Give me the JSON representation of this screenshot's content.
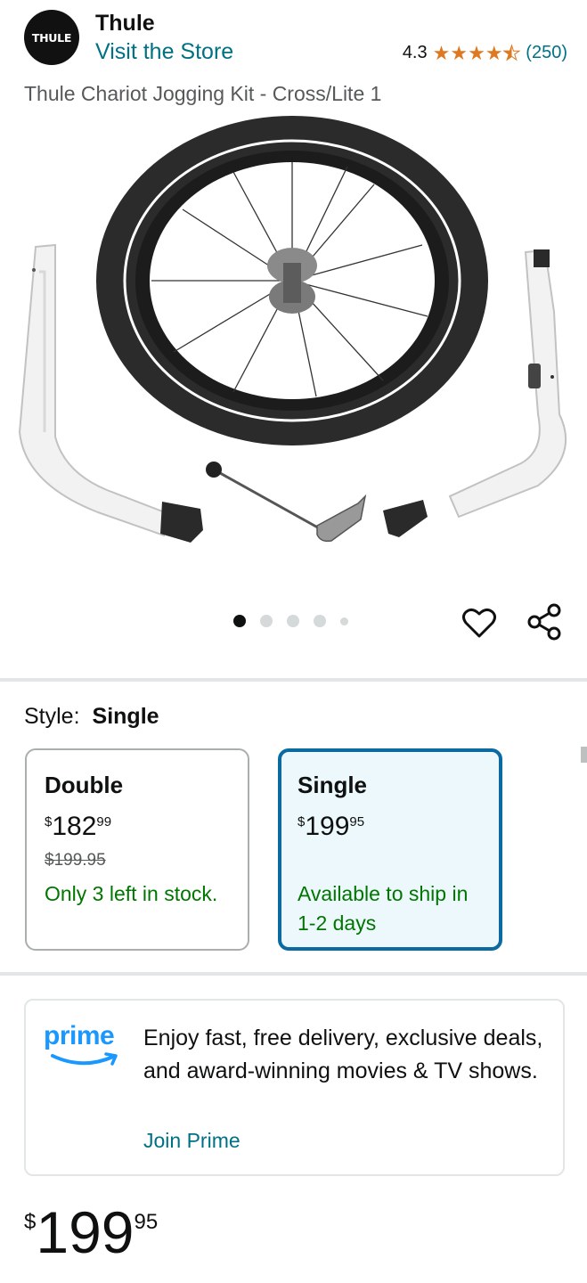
{
  "brand": {
    "logo_text": "THULE",
    "name": "Thule",
    "visit_store": "Visit the Store",
    "rating_value": "4.3",
    "rating_count": "(250)",
    "stars": 4.3
  },
  "product": {
    "title": "Thule Chariot Jogging Kit - Cross/Lite 1"
  },
  "gallery": {
    "image_count": 5,
    "active_index": 0
  },
  "style": {
    "label": "Style:",
    "selected": "Single",
    "options": [
      {
        "name": "Double",
        "price_symbol": "$",
        "price_whole": "182",
        "price_fraction": "99",
        "list_price": "$199.95",
        "availability": "Only 3 left in stock."
      },
      {
        "name": "Single",
        "price_symbol": "$",
        "price_whole": "199",
        "price_fraction": "95",
        "list_price": "",
        "availability": "Available to ship in 1-2 days"
      }
    ]
  },
  "prime": {
    "logo_text": "prime",
    "text": "Enjoy fast, free delivery, exclusive deals, and award-winning movies & TV shows.",
    "join_label": "Join Prime"
  },
  "price": {
    "symbol": "$",
    "whole": "199",
    "fraction": "95"
  },
  "colors": {
    "link": "#007185",
    "star": "#de7921",
    "in_stock": "#007600",
    "selected_border": "#0a6aa1",
    "selected_bg": "#edf8fd",
    "prime_blue": "#1a98ff"
  }
}
